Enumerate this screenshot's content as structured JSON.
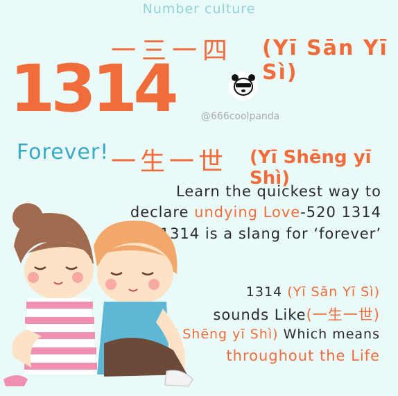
{
  "header": "Number culture",
  "chinese_1": "一三一四",
  "pinyin_1": "(Yī Sān Yī Sì)",
  "big_number": "1314",
  "forever_label": "Forever!",
  "handle": "@666coolpanda",
  "chinese_2": "一生一世",
  "pinyin_2": "(Yī Shēng yī Shì)",
  "para1": {
    "line1": "Learn the quickest way to",
    "line2_a": "declare ",
    "line2_b": "undying Love",
    "line2_c": "-520 1314",
    "line3": "1314 is a slang for ‘forever’"
  },
  "para2": {
    "line1_a": "1314 ",
    "line1_b": "(Yī Sān Yī Sì)",
    "line2_a": "sounds Like",
    "line2_b": "(一生一世)",
    "line3_a": "(Yī Shēng yī Shì)",
    "line3_b": " Which means",
    "line4": "throughout the Life"
  },
  "colors": {
    "orange": "#f06c3b",
    "teal": "#3aa9c4",
    "header": "#8fd3d8",
    "background": "#eafaf8"
  }
}
